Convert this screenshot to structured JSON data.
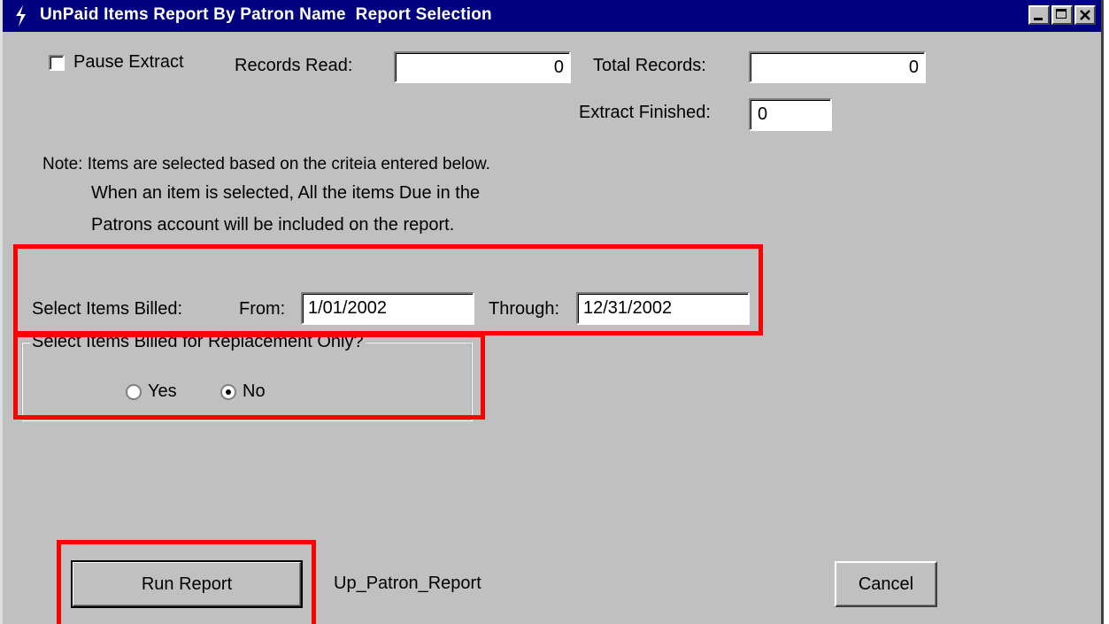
{
  "window": {
    "title": "UnPaid Items Report By Patron Name  Report Selection"
  },
  "extract": {
    "pause_label": "Pause Extract",
    "pause_checked": false,
    "records_read_label": "Records Read:",
    "records_read_value": "0",
    "total_records_label": "Total Records:",
    "total_records_value": "0",
    "finished_label": "Extract Finished:",
    "finished_value": "0"
  },
  "note": {
    "line1": "Note: Items are selected based on the criteia entered below.",
    "line2": "When an item is selected, All the items Due in the",
    "line3": "Patrons account will be included on the report."
  },
  "billed": {
    "label": "Select Items Billed:",
    "from_label": "From:",
    "from_value": "1/01/2002",
    "through_label": "Through:",
    "through_value": "12/31/2002"
  },
  "replacement": {
    "group_label": "Select Items Billed for Replacement Only?",
    "yes_label": "Yes",
    "no_label": "No",
    "selected": "No"
  },
  "footer": {
    "run_label": "Run Report",
    "report_name": "Up_Patron_Report",
    "cancel_label": "Cancel"
  },
  "colors": {
    "titlebar": "#000080",
    "window": "#c0c0c0",
    "highlight": "#ff0000"
  }
}
